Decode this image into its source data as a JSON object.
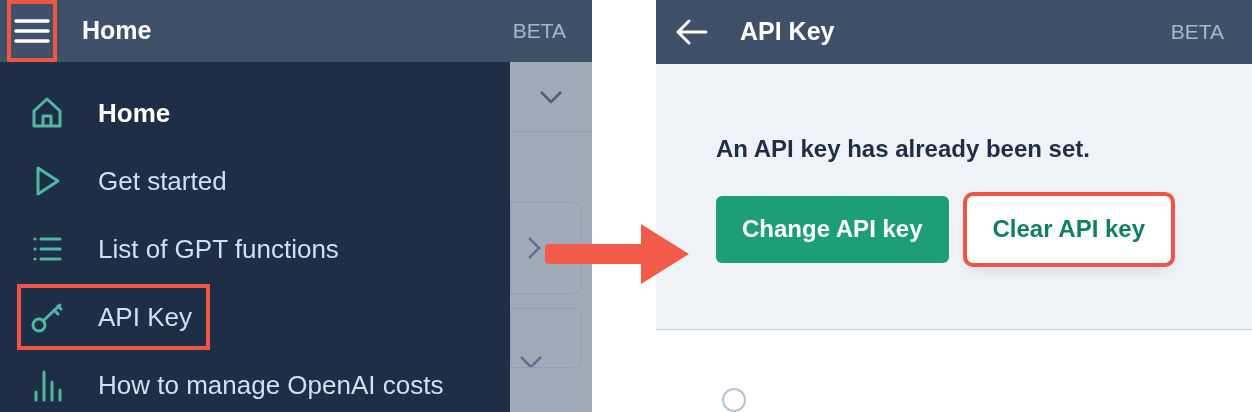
{
  "left_header": {
    "title": "Home",
    "badge": "BETA",
    "menu_highlighted": true
  },
  "sidebar": {
    "items": [
      {
        "label": "Home",
        "kind": "home",
        "selected": true,
        "highlighted": false
      },
      {
        "label": "Get started",
        "kind": "play",
        "selected": false,
        "highlighted": false
      },
      {
        "label": "List of GPT functions",
        "kind": "list",
        "selected": false,
        "highlighted": false
      },
      {
        "label": "API Key",
        "kind": "key",
        "selected": false,
        "highlighted": true
      },
      {
        "label": "How to manage OpenAI costs",
        "kind": "chart",
        "selected": false,
        "highlighted": false
      }
    ]
  },
  "right_header": {
    "title": "API Key",
    "badge": "BETA"
  },
  "message": "An API key has already been set.",
  "buttons": [
    {
      "label": "Change API key",
      "kind": "primary",
      "highlighted": false
    },
    {
      "label": "Clear API key",
      "kind": "secondary",
      "highlighted": true
    }
  ]
}
